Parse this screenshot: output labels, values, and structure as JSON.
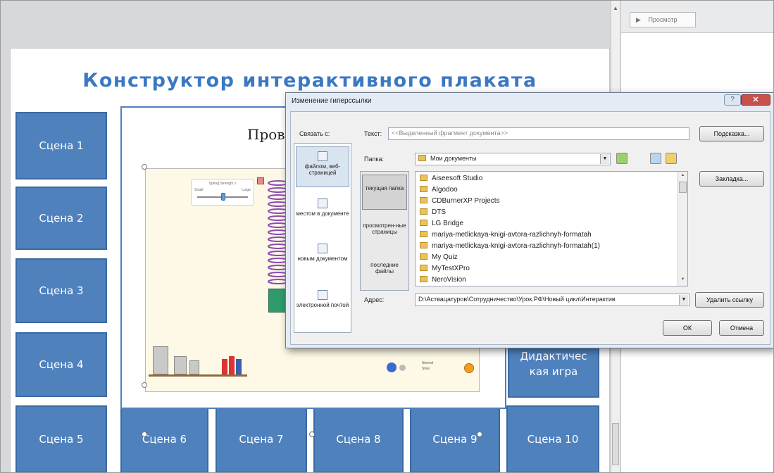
{
  "slide": {
    "title": "Конструктор интерактивного плаката",
    "content_title": "Пров",
    "scenes": [
      "Сцена 1",
      "Сцена 2",
      "Сцена 3",
      "Сцена 4",
      "Сцена 5",
      "Сцена 6",
      "Сцена 7",
      "Сцена 8",
      "Сцена 9",
      "Сцена 10"
    ],
    "didactic_button": "Дидактичес кая игра"
  },
  "simulation": {
    "slider_title": "Spring Strength 1",
    "slider_min": "Small",
    "slider_max": "Large",
    "mode_options": [
      "Normal",
      "Slow"
    ]
  },
  "dialog": {
    "title": "Изменение гиперссылки",
    "help_label": "?",
    "close_label": "✕",
    "link_to_label": "Связать с:",
    "link_options": [
      "файлом, веб-страницей",
      "местом в документе",
      "новым документом",
      "электронной почтой"
    ],
    "text_label": "Текст:",
    "text_value": "<<Выделенный фрагмент документа>>",
    "hint_button": "Подсказка...",
    "folder_label": "Папка:",
    "folder_value": "Мои документы",
    "folder_categories": [
      "текущая папка",
      "просмотрен-ные страницы",
      "последние файлы"
    ],
    "files": [
      "Aiseesoft Studio",
      "Algodoo",
      "CDBurnerXP Projects",
      "DTS",
      "LG Bridge",
      "mariya-metlickaya-knigi-avtora-razlichnyh-formatah",
      "mariya-metlickaya-knigi-avtora-razlichnyh-formatah(1)",
      "My Quiz",
      "MyTestXPro",
      "NeroVision"
    ],
    "bookmark_button": "Закладка...",
    "address_label": "Адрес:",
    "address_value": "D:\\Аствацатуров\\Сотрудничество\\Урок.РФ\\Новый цикл\\Интерактив",
    "remove_link_button": "Удалить ссылку",
    "ok_button": "ОК",
    "cancel_button": "Отмена"
  },
  "preview": {
    "label": "Просмотр"
  },
  "colors": {
    "scene_fill": "#4f81bd",
    "title_blue": "#3b78c2",
    "dialog_bg": "#f0f0f0"
  }
}
